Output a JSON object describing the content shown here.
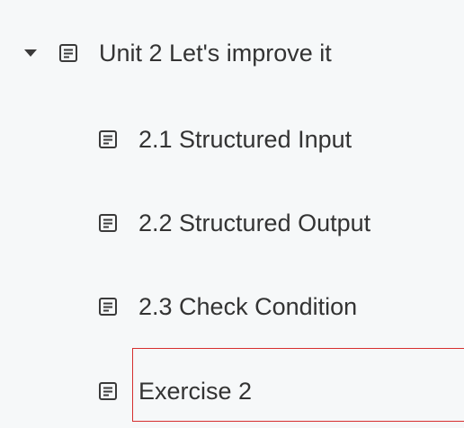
{
  "tree": {
    "unit": {
      "label": "Unit 2 Let's improve it",
      "expanded": true,
      "icons": [
        "caret-down-icon",
        "document-icon"
      ]
    },
    "children": [
      {
        "label": "2.1 Structured Input",
        "icon": "document-icon"
      },
      {
        "label": "2.2 Structured Output",
        "icon": "document-icon"
      },
      {
        "label": "2.3 Check Condition",
        "icon": "document-icon"
      },
      {
        "label": "Exercise 2",
        "icon": "document-icon",
        "highlighted": true
      }
    ]
  },
  "colors": {
    "background": "#f6f8f9",
    "text": "#333333",
    "icon": "#3a3a3a",
    "highlight_border": "#d62f2f"
  }
}
